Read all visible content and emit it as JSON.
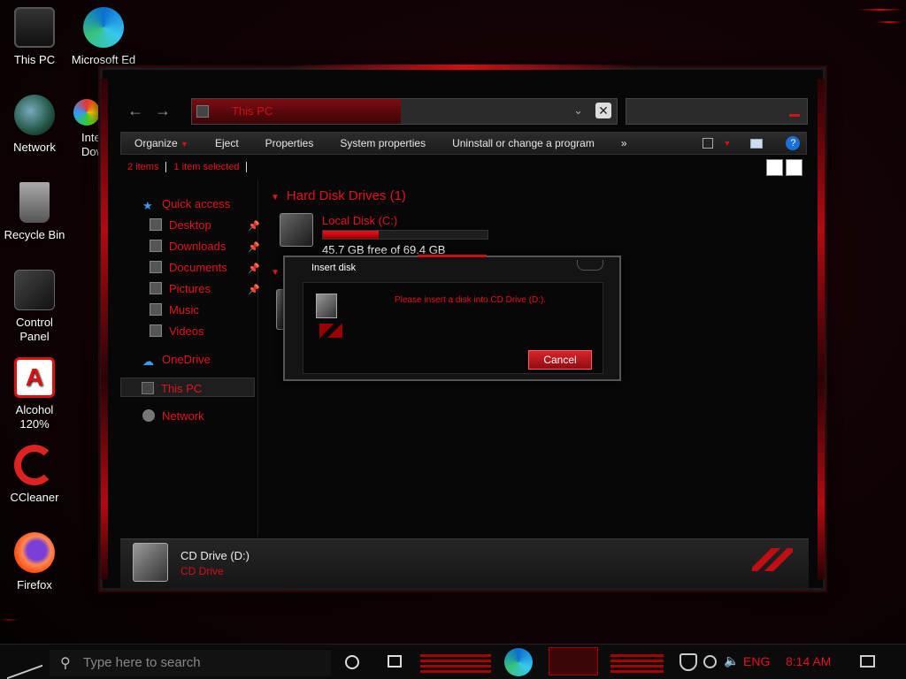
{
  "desktop": {
    "icons": [
      {
        "label": "This PC",
        "icon": "this-pc-icon"
      },
      {
        "label": "Microsoft Ed",
        "icon": "edge-icon"
      },
      {
        "label": "Network",
        "icon": "network-globe-icon"
      },
      {
        "label": "Inte Dow",
        "icon": "internet-download-icon"
      },
      {
        "label": "Recycle Bin",
        "icon": "recycle-bin-icon"
      },
      {
        "label": "Control Panel",
        "icon": "control-panel-icon"
      },
      {
        "label": "Alcohol 120%",
        "icon": "alcohol-icon"
      },
      {
        "label": "CCleaner",
        "icon": "ccleaner-icon"
      },
      {
        "label": "Firefox",
        "icon": "firefox-icon"
      }
    ]
  },
  "explorer": {
    "address": "This PC",
    "toolbar": [
      "Organize",
      "Eject",
      "Properties",
      "System properties",
      "Uninstall or change a program",
      "»"
    ],
    "status": {
      "items": "2 items",
      "selected": "1 item selected"
    },
    "nav": {
      "quick_access": "Quick access",
      "items": [
        "Desktop",
        "Downloads",
        "Documents",
        "Pictures",
        "Music",
        "Videos"
      ],
      "onedrive": "OneDrive",
      "thispc": "This PC",
      "network": "Network"
    },
    "section": "Hard Disk Drives (1)",
    "drive": {
      "name": "Local Disk (C:)",
      "free": "45.7 GB free of 69.4 GB",
      "used_fraction": 0.34
    },
    "details": {
      "name": "CD Drive (D:)",
      "type": "CD Drive"
    }
  },
  "dialog": {
    "title": "Insert disk",
    "message": "Please insert a disk into CD Drive (D:).",
    "cancel": "Cancel"
  },
  "taskbar": {
    "search_placeholder": "Type here to search",
    "lang": "ENG",
    "time": "8:14 AM"
  },
  "colors": {
    "accent": "#e0141c",
    "background": "#070707"
  }
}
